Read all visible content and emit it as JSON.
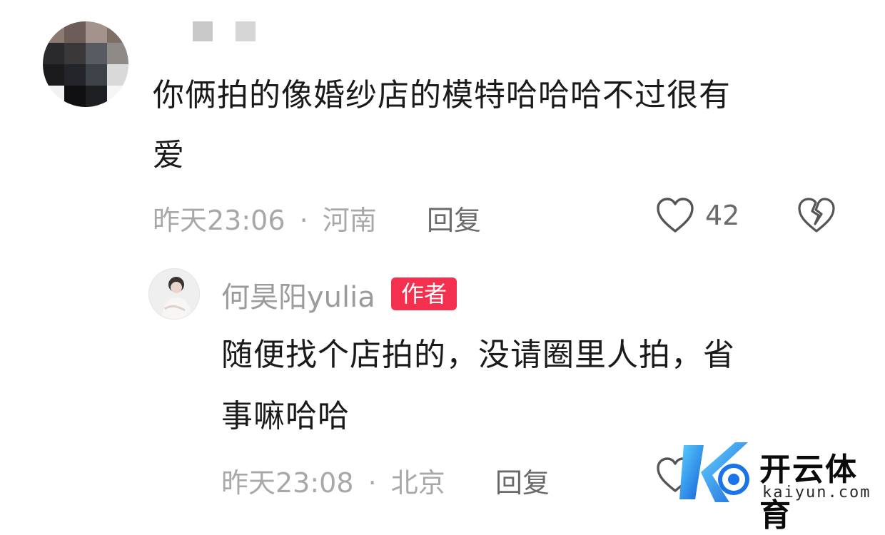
{
  "comment": {
    "text_line1": "你俩拍的像婚纱店的模特哈哈哈不过很有",
    "text_line2": "爱",
    "timestamp": "昨天23:06",
    "separator": "·",
    "location": "河南",
    "reply_label": "回复",
    "like_count": "42"
  },
  "reply": {
    "author": "何昊阳yulia",
    "author_badge": "作者",
    "text_line1": "随便找个店拍的，没请圈里人拍，省",
    "text_line2": "事嘛哈哈",
    "timestamp": "昨天23:08",
    "separator": "·",
    "location": "北京",
    "reply_label": "回复"
  },
  "watermark": {
    "brand": "开云体育",
    "domain": "kaiyun.com"
  },
  "icons": {
    "like": "heart-icon",
    "dislike": "broken-heart-icon"
  },
  "colors": {
    "badge": "#f4304f",
    "meta": "#a8a8a8",
    "text": "#1a1a1a"
  }
}
